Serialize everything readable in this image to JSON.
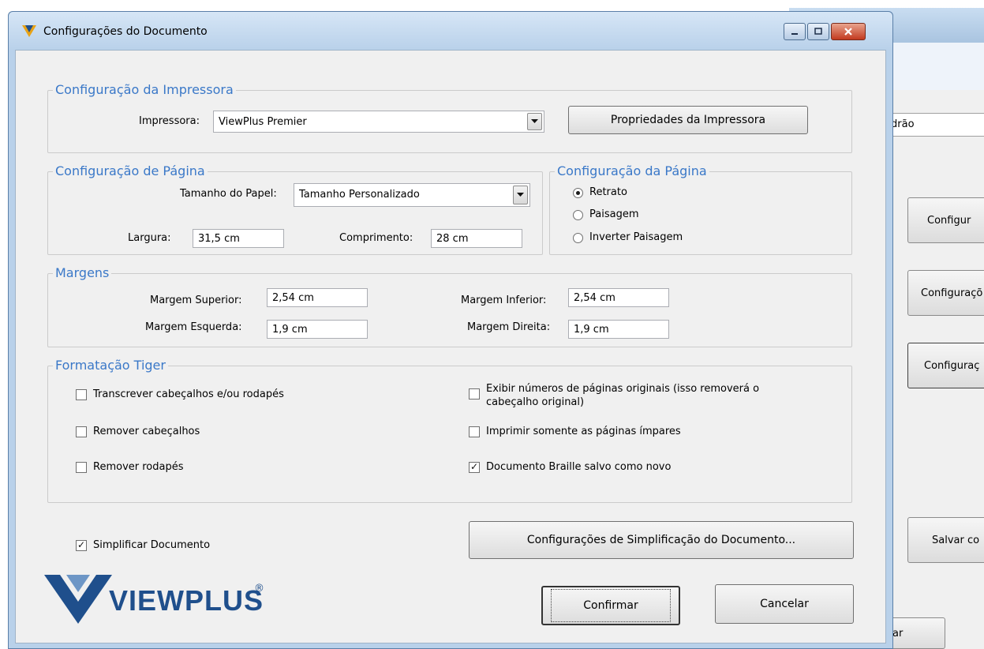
{
  "background_window": {
    "input_value": "drão",
    "buttons": [
      "Configur",
      "Configuraçõ",
      "Configuraç",
      "Salvar co",
      "ar"
    ]
  },
  "dialog": {
    "title": "Configurações do Documento"
  },
  "printer_group": {
    "legend": "Configuração da Impressora",
    "printer_label": "Impressora:",
    "printer_value": "ViewPlus Premier",
    "properties_button": "Propriedades da Impressora"
  },
  "page_group": {
    "legend": "Configuração de Página",
    "paper_size_label": "Tamanho do Papel:",
    "paper_size_value": "Tamanho Personalizado",
    "width_label": "Largura:",
    "width_value": "31,5 cm",
    "length_label": "Comprimento:",
    "length_value": "28 cm"
  },
  "orientation_group": {
    "legend": "Configuração da Página",
    "options": [
      {
        "label": "Retrato",
        "selected": true
      },
      {
        "label": "Paisagem",
        "selected": false
      },
      {
        "label": "Inverter Paisagem",
        "selected": false
      }
    ]
  },
  "margins_group": {
    "legend": "Margens",
    "top_label": "Margem Superior:",
    "top_value": "2,54 cm",
    "bottom_label": "Margem Inferior:",
    "bottom_value": "2,54 cm",
    "left_label": "Margem Esquerda:",
    "left_value": "1,9 cm",
    "right_label": "Margem Direita:",
    "right_value": "1,9 cm"
  },
  "tiger_group": {
    "legend": "Formatação Tiger",
    "options": [
      {
        "label": "Transcrever cabeçalhos e/ou rodapés",
        "checked": false
      },
      {
        "label": "Remover cabeçalhos",
        "checked": false
      },
      {
        "label": "Remover rodapés",
        "checked": false
      },
      {
        "label": "Exibir números de páginas originais (isso removerá o cabeçalho original)",
        "checked": false
      },
      {
        "label": "Imprimir somente as páginas ímpares",
        "checked": false
      },
      {
        "label": "Documento Braille salvo como novo",
        "checked": true
      }
    ]
  },
  "simplify": {
    "label": "Simplificar Documento",
    "checked": true,
    "settings_button": "Configurações de Simplificação do Documento..."
  },
  "logo": {
    "text": "VIEWPLUS",
    "mark": "®"
  },
  "actions": {
    "confirm": "Confirmar",
    "cancel": "Cancelar"
  },
  "colors": {
    "legend_blue": "#3a78c8",
    "logo_blue": "#1f4f8c"
  }
}
